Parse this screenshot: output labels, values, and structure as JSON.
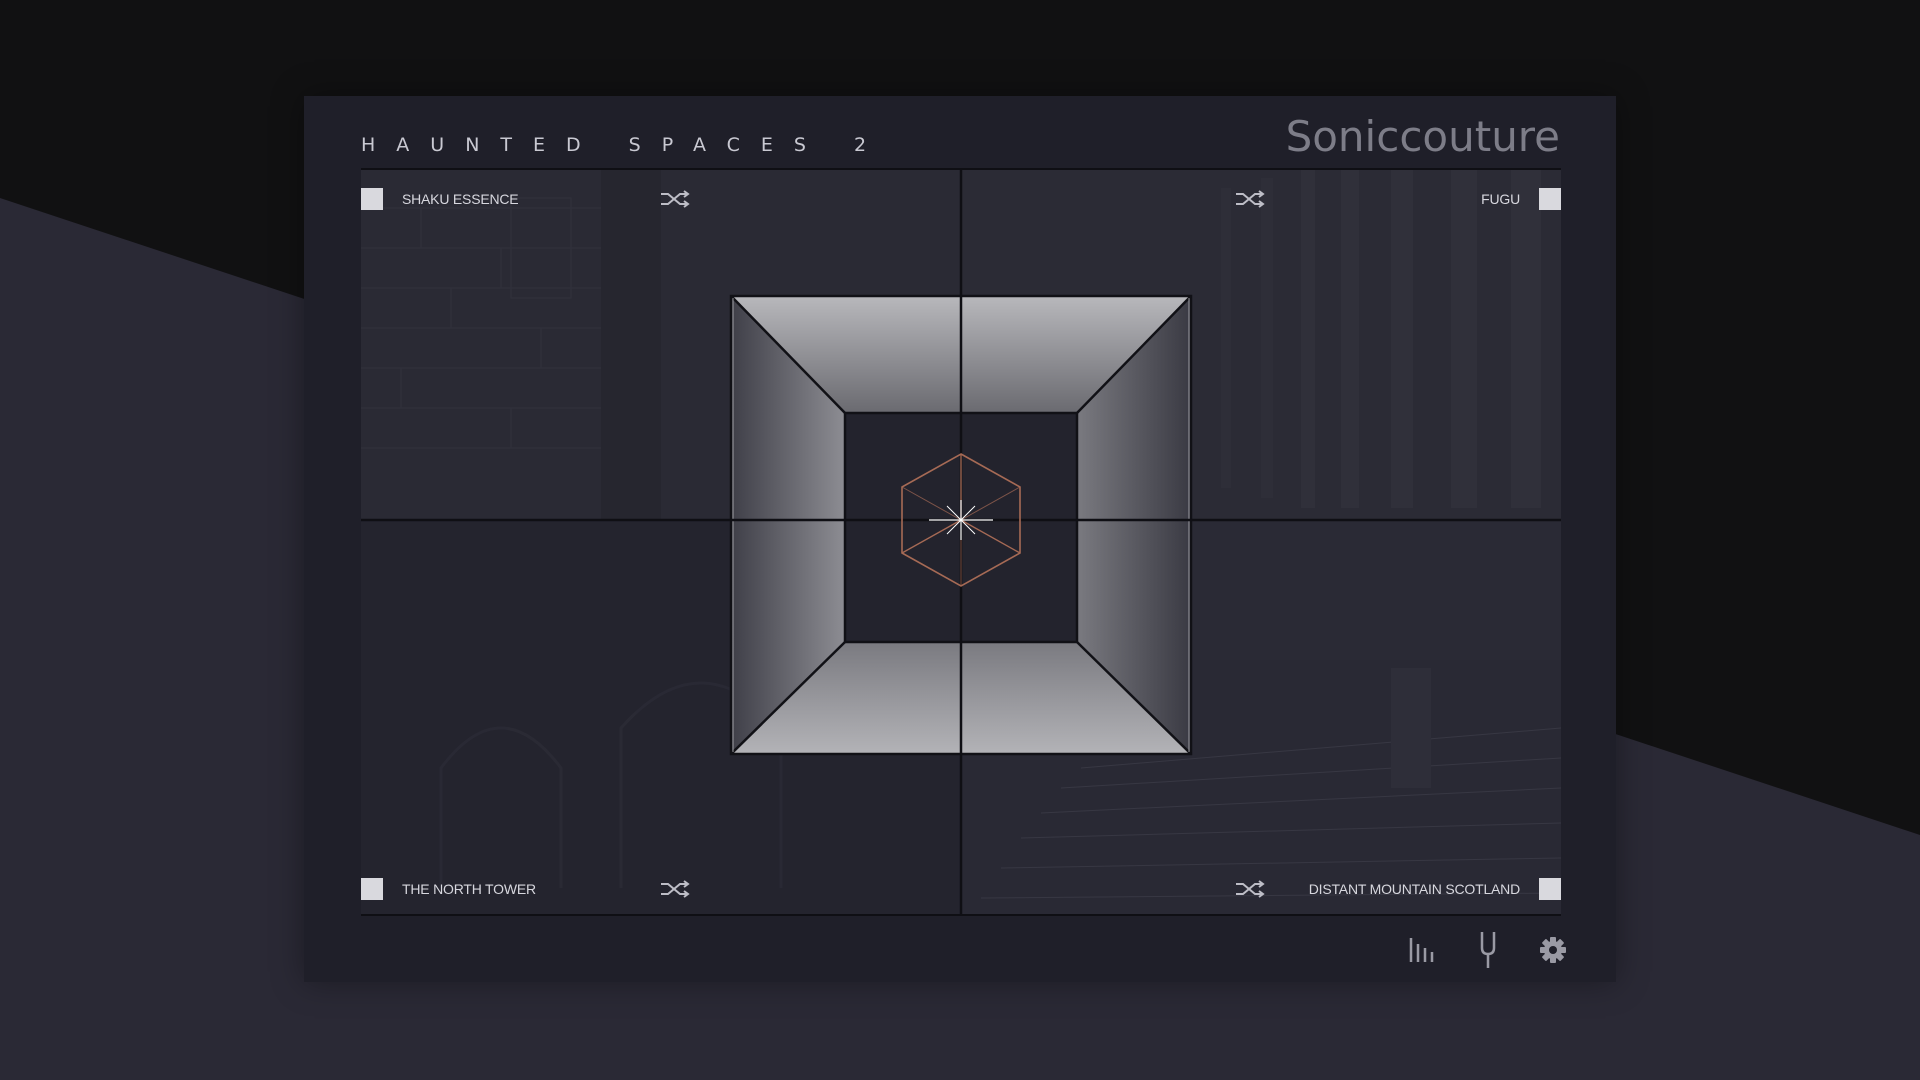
{
  "app": {
    "title": "HAUNTED SPACES 2",
    "brand": "Soniccouture"
  },
  "slots": [
    {
      "id": "top-left",
      "label": "SHAKU ESSENCE",
      "enabled": true,
      "icon": "shuffle-icon"
    },
    {
      "id": "top-right",
      "label": "FUGU",
      "enabled": true,
      "icon": "shuffle-icon"
    },
    {
      "id": "bottom-left",
      "label": "THE NORTH TOWER",
      "enabled": true,
      "icon": "shuffle-icon"
    },
    {
      "id": "bottom-right",
      "label": "DISTANT MOUNTAIN SCOTLAND",
      "enabled": true,
      "icon": "shuffle-icon"
    }
  ],
  "center": {
    "icon": "hexagon-cube-icon",
    "accent": "#a66a55"
  },
  "footer": {
    "buttons": [
      {
        "name": "mixer-bars-icon"
      },
      {
        "name": "tuning-fork-icon"
      },
      {
        "name": "gear-icon"
      }
    ]
  },
  "colors": {
    "panel": "#1f1f29",
    "background_dark": "#111112",
    "background_slab": "#2a2935",
    "checkbox": "#d9d9de"
  }
}
